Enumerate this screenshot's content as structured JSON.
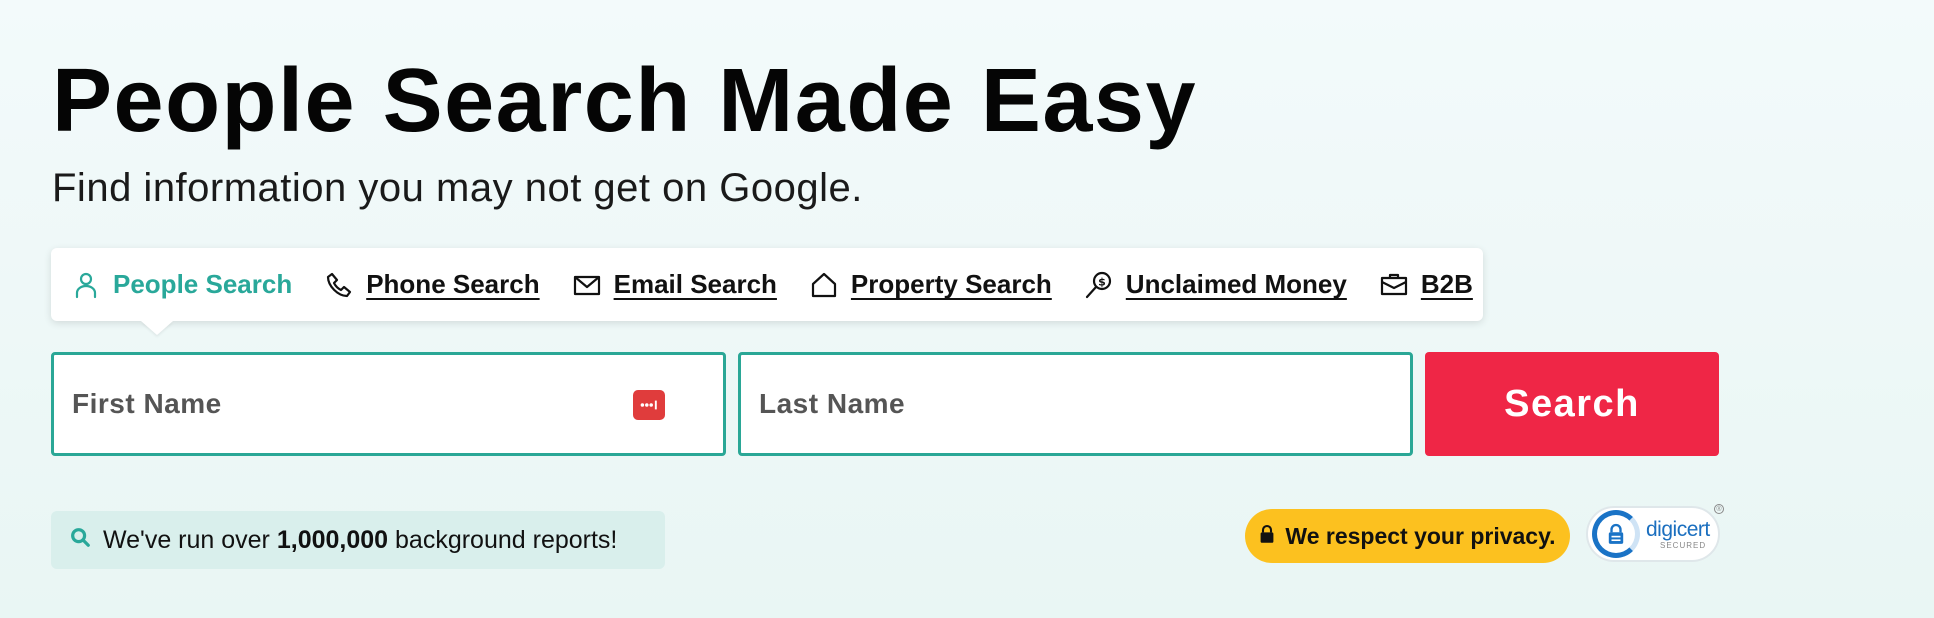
{
  "hero": {
    "title": "People Search Made Easy",
    "subtitle": "Find information you may not get on Google."
  },
  "tabs": [
    {
      "label": "People Search",
      "icon": "person-icon",
      "active": true
    },
    {
      "label": "Phone Search",
      "icon": "phone-icon",
      "active": false
    },
    {
      "label": "Email Search",
      "icon": "envelope-icon",
      "active": false
    },
    {
      "label": "Property Search",
      "icon": "house-icon",
      "active": false
    },
    {
      "label": "Unclaimed Money",
      "icon": "magnifier-dollar-icon",
      "active": false
    },
    {
      "label": "B2B",
      "icon": "briefcase-icon",
      "active": false
    }
  ],
  "form": {
    "first_name_placeholder": "First Name",
    "last_name_placeholder": "Last Name",
    "search_label": "Search"
  },
  "stats": {
    "prefix": "We've run over",
    "count": "1,000,000",
    "suffix": "background reports!"
  },
  "privacy": {
    "label": "We respect your privacy."
  },
  "seal": {
    "brand": "digicert",
    "sub": "SECURED",
    "reg": "®"
  },
  "colors": {
    "accent": "#29a89a",
    "search_button": "#ef2646",
    "privacy_pill": "#fcc11f",
    "stats_bg": "#d9efec",
    "password_manager": "#e03c3c"
  }
}
